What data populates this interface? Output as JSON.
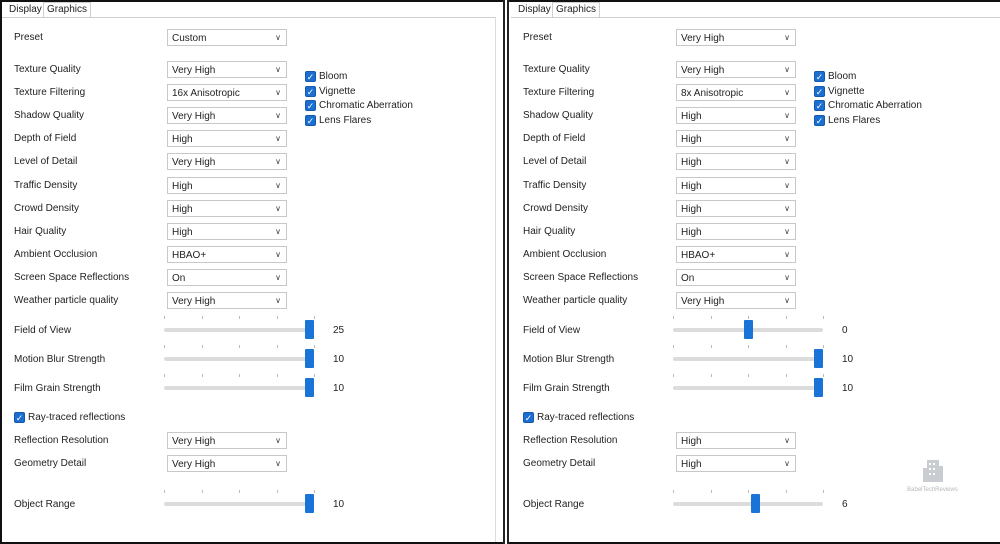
{
  "panels": {
    "left": {
      "tabs": [
        "Display",
        "Graphics"
      ],
      "preset": {
        "label": "Preset",
        "value": "Custom"
      },
      "settings": [
        {
          "label": "Texture Quality",
          "value": "Very High"
        },
        {
          "label": "Texture Filtering",
          "value": "16x Anisotropic"
        },
        {
          "label": "Shadow Quality",
          "value": "Very High"
        },
        {
          "label": "Depth of Field",
          "value": "High"
        },
        {
          "label": "Level of Detail",
          "value": "Very High"
        },
        {
          "label": "Traffic Density",
          "value": "High"
        },
        {
          "label": "Crowd Density",
          "value": "High"
        },
        {
          "label": "Hair Quality",
          "value": "High"
        },
        {
          "label": "Ambient Occlusion",
          "value": "HBAO+"
        },
        {
          "label": "Screen Space Reflections",
          "value": "On"
        },
        {
          "label": "Weather particle quality",
          "value": "Very High"
        }
      ],
      "effects": [
        {
          "label": "Bloom",
          "checked": true
        },
        {
          "label": "Vignette",
          "checked": true
        },
        {
          "label": "Chromatic Aberration",
          "checked": true
        },
        {
          "label": "Lens Flares",
          "checked": true
        }
      ],
      "sliders": [
        {
          "label": "Field of View",
          "value": "25",
          "fraction": 1.0
        },
        {
          "label": "Motion Blur Strength",
          "value": "10",
          "fraction": 1.0
        },
        {
          "label": "Film Grain Strength",
          "value": "10",
          "fraction": 1.0
        }
      ],
      "raytraced": {
        "label": "Ray-traced reflections",
        "checked": true
      },
      "rt_settings": [
        {
          "label": "Reflection Resolution",
          "value": "Very High"
        },
        {
          "label": "Geometry Detail",
          "value": "Very High"
        }
      ],
      "object_range": {
        "label": "Object Range",
        "value": "10",
        "fraction": 1.0
      }
    },
    "right": {
      "tabs": [
        "Display",
        "Graphics"
      ],
      "preset": {
        "label": "Preset",
        "value": "Very High"
      },
      "settings": [
        {
          "label": "Texture Quality",
          "value": "Very High"
        },
        {
          "label": "Texture Filtering",
          "value": "8x Anisotropic"
        },
        {
          "label": "Shadow Quality",
          "value": "High"
        },
        {
          "label": "Depth of Field",
          "value": "High"
        },
        {
          "label": "Level of Detail",
          "value": "High"
        },
        {
          "label": "Traffic Density",
          "value": "High"
        },
        {
          "label": "Crowd Density",
          "value": "High"
        },
        {
          "label": "Hair Quality",
          "value": "High"
        },
        {
          "label": "Ambient Occlusion",
          "value": "HBAO+"
        },
        {
          "label": "Screen Space Reflections",
          "value": "On"
        },
        {
          "label": "Weather particle quality",
          "value": "Very High"
        }
      ],
      "effects": [
        {
          "label": "Bloom",
          "checked": true
        },
        {
          "label": "Vignette",
          "checked": true
        },
        {
          "label": "Chromatic Aberration",
          "checked": true
        },
        {
          "label": "Lens Flares",
          "checked": true
        }
      ],
      "sliders": [
        {
          "label": "Field of View",
          "value": "0",
          "fraction": 0.5
        },
        {
          "label": "Motion Blur Strength",
          "value": "10",
          "fraction": 1.0
        },
        {
          "label": "Film Grain Strength",
          "value": "10",
          "fraction": 1.0
        }
      ],
      "raytraced": {
        "label": "Ray-traced reflections",
        "checked": true
      },
      "rt_settings": [
        {
          "label": "Reflection Resolution",
          "value": "High"
        },
        {
          "label": "Geometry Detail",
          "value": "High"
        }
      ],
      "object_range": {
        "label": "Object Range",
        "value": "6",
        "fraction": 0.55
      }
    }
  },
  "icons": {
    "dropdown": "chevron-down-icon",
    "check": "checkmark-icon",
    "watermark": "building-logo-icon"
  },
  "colors": {
    "accent": "#1a73d6",
    "check": "#1a6fd1"
  },
  "watermark_text": "BabelTechReviews"
}
